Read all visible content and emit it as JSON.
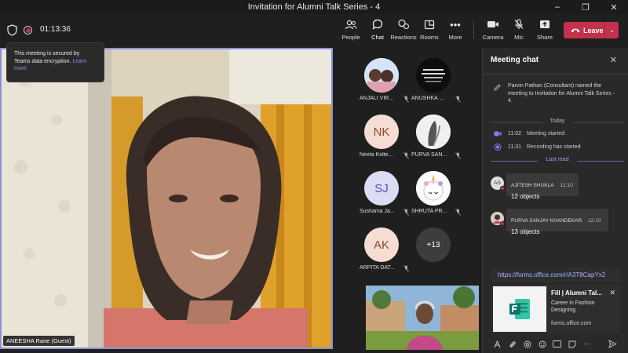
{
  "window": {
    "title": "Invitation for Alumni Talk Series - 4",
    "controls": {
      "minimize": "–",
      "restore": "❐",
      "close": "✕"
    }
  },
  "toolbar": {
    "timer": "01:13:36",
    "buttons": [
      {
        "label": "People",
        "icon": "people-icon"
      },
      {
        "label": "Chat",
        "icon": "chat-icon"
      },
      {
        "label": "Reactions",
        "icon": "reactions-icon"
      },
      {
        "label": "Rooms",
        "icon": "rooms-icon"
      },
      {
        "label": "More",
        "icon": "more-icon"
      },
      {
        "label": "Camera",
        "icon": "camera-icon"
      },
      {
        "label": "Mic",
        "icon": "mic-icon"
      },
      {
        "label": "Share",
        "icon": "share-icon"
      }
    ],
    "leave_label": "Leave",
    "leave_color": "#c4314b"
  },
  "tooltip": {
    "text": "This meeting is secured by Teams data encryption.",
    "link": "Learn more"
  },
  "main_video": {
    "name": "ANEESHA Rane (Guest)"
  },
  "participants": [
    {
      "name": "ANJALI VIR...",
      "initials": "",
      "type": "photo"
    },
    {
      "name": "ANUSHKA ...",
      "initials": "",
      "type": "photo"
    },
    {
      "name": "Neeta Kolte...",
      "initials": "NK",
      "type": "initials",
      "bg": "#f6ddd3",
      "fg": "#8a4b2f"
    },
    {
      "name": "PURVA SAN...",
      "initials": "",
      "type": "photo"
    },
    {
      "name": "Sushama Ja...",
      "initials": "SJ",
      "type": "initials",
      "bg": "#dcdcf5",
      "fg": "#4f52b2"
    },
    {
      "name": "SHRUTA PR...",
      "initials": "",
      "type": "photo"
    },
    {
      "name": "ARPITA DAT...",
      "initials": "AK",
      "type": "initials",
      "bg": "#f6ddd3",
      "fg": "#8a4b2f"
    },
    {
      "name": "",
      "initials": "+13",
      "type": "overflow",
      "bg": "#3d3d3d",
      "fg": "#ffffff"
    }
  ],
  "chat": {
    "title": "Meeting chat",
    "system_message": "Parvin Pathan (Consultant) named the meeting to Invitation for Alumni Talk Series - 4.",
    "day_separator": "Today",
    "events": [
      {
        "time": "11:02",
        "text": "Meeting started"
      },
      {
        "time": "11:31",
        "text": "Recording has started"
      }
    ],
    "last_read": "Last read",
    "messages": [
      {
        "author": "AJITESH SHUKLA",
        "time": "12:10",
        "text": "12 objects",
        "initials": "AS"
      },
      {
        "author": "PURVA SANJAY KHANDEKAR",
        "time": "12:10",
        "text": "13 objects",
        "initials": ""
      }
    ],
    "link": "https://forms.office.com/r/A3T8CapYx2",
    "card": {
      "title": "Fill | Alumni Tal...",
      "description": "Career in Fashion Designing",
      "domain": "forms.office.com"
    }
  }
}
